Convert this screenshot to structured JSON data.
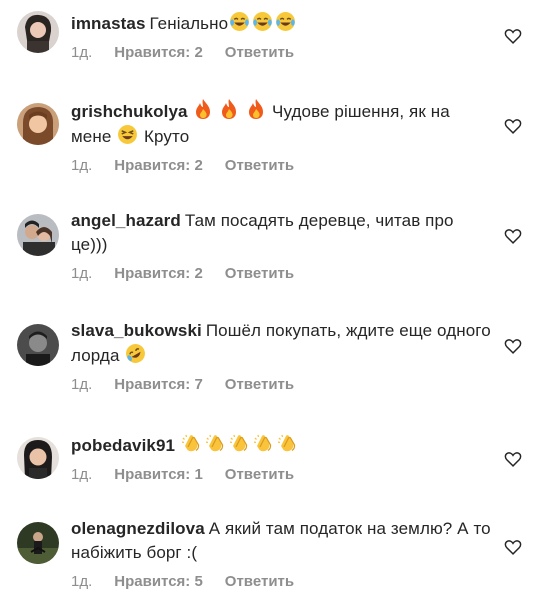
{
  "comments": [
    {
      "username": "imnastas",
      "text": "Геніально",
      "time": "1д.",
      "likes": "Нравится: 2",
      "reply": "Ответить",
      "emoji": [
        "laughing-tears-emoji",
        "laughing-tears-emoji",
        "laughing-tears-emoji"
      ]
    },
    {
      "username": "grishchukolya",
      "text_before": "",
      "text_after": "Чудове рішення, як на мене",
      "text_end": "Круто",
      "time": "1д.",
      "likes": "Нравится: 2",
      "reply": "Ответить"
    },
    {
      "username": "angel_hazard",
      "text": "Там посадять деревце, читав про це)))",
      "time": "1д.",
      "likes": "Нравится: 2",
      "reply": "Ответить"
    },
    {
      "username": "slava_bukowski",
      "text": "Пошёл покупать, ждите еще одного лорда",
      "time": "1д.",
      "likes": "Нравится: 7",
      "reply": "Ответить"
    },
    {
      "username": "pobedavik91",
      "text": "",
      "time": "1д.",
      "likes": "Нравится: 1",
      "reply": "Ответить"
    },
    {
      "username": "olenagnezdilova",
      "text": "А який там податок на землю? А то набіжить борг :(",
      "time": "1д.",
      "likes": "Нравится: 5",
      "reply": "Ответить"
    }
  ],
  "colors": {
    "text": "#262626",
    "muted": "#8e8e8e",
    "heart_stroke": "#262626"
  }
}
